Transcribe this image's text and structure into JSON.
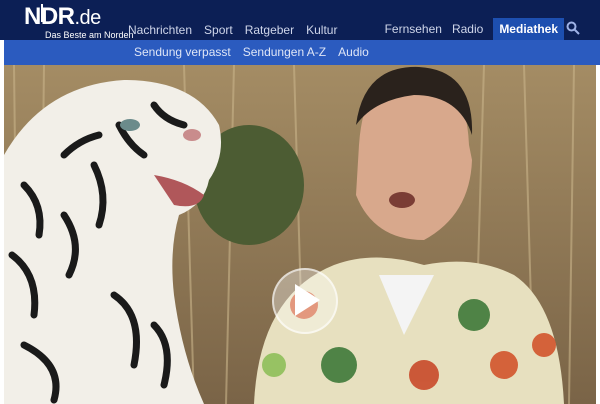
{
  "header": {
    "logo": {
      "brand": "NDR",
      "tld": ".de",
      "tagline": "Das Beste am Norden"
    },
    "nav_main": [
      "Nachrichten",
      "Sport",
      "Ratgeber",
      "Kultur"
    ],
    "nav_right": [
      "Fernsehen",
      "Radio",
      "Mediathek"
    ],
    "active_nav": "Mediathek"
  },
  "subnav": [
    "Sendung verpasst",
    "Sendungen A-Z",
    "Audio"
  ],
  "colors": {
    "header_bg": "#0c1f55",
    "subbar_bg": "#2b5bbf",
    "active_bg": "#1d4fb0"
  },
  "icons": {
    "search": "search-icon",
    "play": "play-icon"
  }
}
